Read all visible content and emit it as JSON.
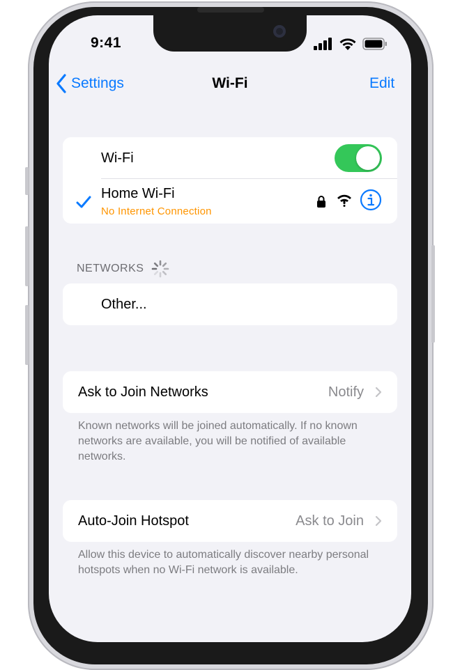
{
  "status_bar": {
    "time": "9:41"
  },
  "nav": {
    "back_label": "Settings",
    "title": "Wi-Fi",
    "edit_label": "Edit"
  },
  "wifi_group": {
    "toggle_label": "Wi-Fi",
    "toggle_on": true,
    "connected_network": "Home Wi-Fi",
    "connection_status": "No Internet Connection"
  },
  "networks_section": {
    "header": "NETWORKS",
    "other_label": "Other..."
  },
  "ask_to_join": {
    "label": "Ask to Join Networks",
    "value": "Notify",
    "footnote": "Known networks will be joined automatically. If no known networks are available, you will be notified of available networks."
  },
  "auto_join_hotspot": {
    "label": "Auto-Join Hotspot",
    "value": "Ask to Join",
    "footnote": "Allow this device to automatically discover nearby personal hotspots when no Wi-Fi network is available."
  },
  "colors": {
    "accent": "#0a7aff",
    "toggle_on": "#34c759",
    "warning": "#ff9500",
    "background": "#f2f2f7"
  },
  "icons": [
    "back-chevron-icon",
    "cellular-signal-icon",
    "wifi-signal-icon",
    "battery-icon",
    "checkmark-icon",
    "lock-icon",
    "wifi-warning-icon",
    "info-icon",
    "loading-spinner-icon",
    "chevron-right-icon"
  ]
}
